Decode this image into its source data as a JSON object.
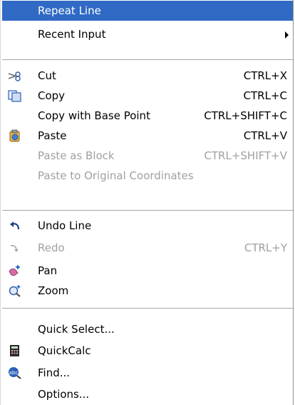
{
  "menu": {
    "items": {
      "repeat_line": {
        "label": "Repeat Line"
      },
      "recent_input": {
        "label": "Recent Input"
      },
      "cut": {
        "label": "Cut",
        "shortcut": "CTRL+X",
        "icon": "scissors-icon"
      },
      "copy": {
        "label": "Copy",
        "shortcut": "CTRL+C",
        "icon": "copy-icon"
      },
      "copy_base_point": {
        "label": "Copy with Base Point",
        "shortcut": "CTRL+SHIFT+C"
      },
      "paste": {
        "label": "Paste",
        "shortcut": "CTRL+V",
        "icon": "paste-icon"
      },
      "paste_as_block": {
        "label": "Paste as Block",
        "shortcut": "CTRL+SHIFT+V",
        "disabled": true
      },
      "paste_original_coords": {
        "label": "Paste to Original Coordinates",
        "disabled": true
      },
      "undo_line": {
        "label": "Undo Line",
        "icon": "undo-icon"
      },
      "redo": {
        "label": "Redo",
        "shortcut": "CTRL+Y",
        "icon": "redo-icon",
        "disabled": true
      },
      "pan": {
        "label": "Pan",
        "icon": "pan-hand-icon"
      },
      "zoom": {
        "label": "Zoom",
        "icon": "zoom-icon"
      },
      "quick_select": {
        "label": "Quick Select..."
      },
      "quickcalc": {
        "label": "QuickCalc",
        "icon": "calculator-icon"
      },
      "find": {
        "label": "Find...",
        "icon": "find-icon"
      },
      "options": {
        "label": "Options..."
      }
    }
  },
  "colors": {
    "highlight": "#316ac5",
    "disabled_text": "#a0a0a0"
  }
}
